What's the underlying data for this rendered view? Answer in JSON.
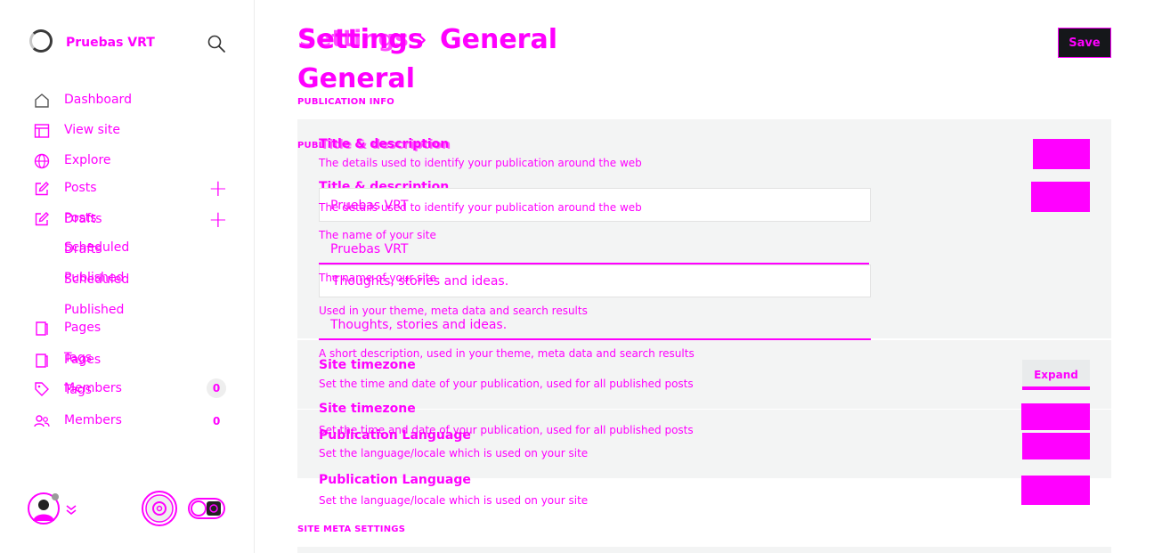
{
  "brand": {
    "name": "Pruebas VRT"
  },
  "nav": {
    "dashboard": "Dashboard",
    "view_site": "View site",
    "explore": "Explore",
    "posts": "Posts",
    "posts_dup": "Posts",
    "drafts": "Drafts",
    "drafts_dup": "Drafts",
    "scheduled": "Scheduled",
    "scheduled_dup": "Scheduled",
    "published": "Published",
    "published_dup": "Published",
    "pages": "Pages",
    "pages_dup": "Pages",
    "tags": "Tags",
    "tags_dup": "Tags",
    "members": "Members",
    "members_dup": "Members",
    "members_count": "0",
    "members_count_dup": "0"
  },
  "header": {
    "breadcrumb_parent": "Settings",
    "breadcrumb_separator": "›",
    "breadcrumb_current": "General",
    "breadcrumb_overlap": "Settings",
    "page_title": "General",
    "save_label": "Save"
  },
  "sections": {
    "publication_info": "PUBLICATION INFO",
    "publication_info_overlap": "PUBL",
    "site_meta": "SITE META SETTINGS"
  },
  "title_desc": {
    "heading": "Title & description",
    "heading_overlap": "Title & description",
    "desc": "The details used to identify your publication around the web",
    "heading_2": "Title & description",
    "desc_2": "The details used to identify your publication around the web",
    "title_value": "Pruebas VRT",
    "title_help": "The name of your site",
    "title_value_2": "Pruebas VRT",
    "title_help_2": "The name of your site",
    "desc_value": "Thoughts, stories and ideas.",
    "desc_help": "Used in your theme, meta data and search results",
    "desc_value_2": "Thoughts, stories and ideas.",
    "desc_help_2": "A short description, used in your theme, meta data and search results"
  },
  "timezone": {
    "heading": "Site timezone",
    "desc": "Set the time and date of your publication, used for all published posts",
    "heading_2": "Site timezone",
    "desc_2": "Set the time and date of your publication, used for all published posts",
    "expand_label": "Expand"
  },
  "language": {
    "heading": "Publication Language",
    "desc": "Set the language/locale which is used on your site",
    "heading_2": "Publication Language",
    "desc_2": "Set the language/locale which is used on your site"
  },
  "colors": {
    "accent": "#ff00ff",
    "panel": "#f3f4f4",
    "dark": "#15171a"
  }
}
